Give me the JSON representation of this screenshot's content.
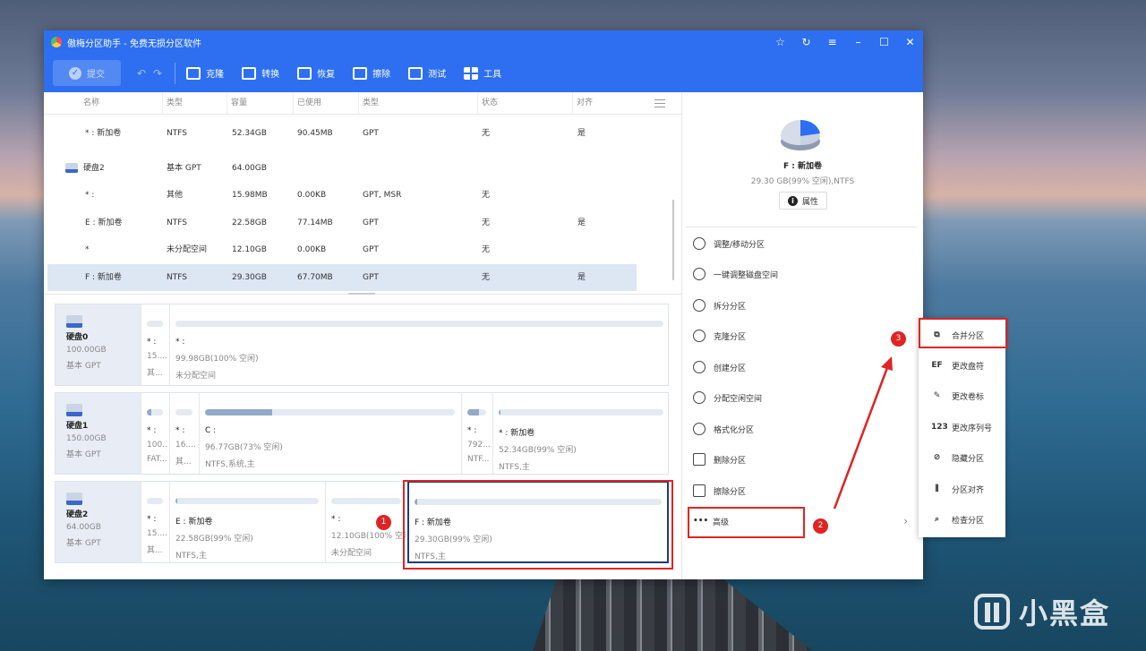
{
  "window": {
    "title": "傲梅分区助手 - 免费无损分区软件"
  },
  "toolbar": {
    "submit": "提交",
    "buttons": [
      {
        "label": "克隆",
        "icon": "clone-icon"
      },
      {
        "label": "转换",
        "icon": "convert-icon"
      },
      {
        "label": "恢复",
        "icon": "recover-icon"
      },
      {
        "label": "擦除",
        "icon": "wipe-icon"
      },
      {
        "label": "测试",
        "icon": "test-icon"
      },
      {
        "label": "工具",
        "icon": "tools-icon"
      }
    ]
  },
  "table": {
    "headers": [
      "名称",
      "类型",
      "容量",
      "已使用",
      "类型",
      "状态",
      "对齐"
    ],
    "rows": [
      {
        "name": "* : 新加卷",
        "type": "NTFS",
        "capacity": "52.34GB",
        "used": "90.45MB",
        "fs": "GPT",
        "status": "无",
        "align": "是"
      },
      {
        "name": "硬盘2",
        "type": "基本 GPT",
        "capacity": "64.00GB",
        "used": "",
        "fs": "",
        "status": "",
        "align": ""
      },
      {
        "name": "* :",
        "type": "其他",
        "capacity": "15.98MB",
        "used": "0.00KB",
        "fs": "GPT, MSR",
        "status": "无",
        "align": ""
      },
      {
        "name": "E : 新加卷",
        "type": "NTFS",
        "capacity": "22.58GB",
        "used": "77.14MB",
        "fs": "GPT",
        "status": "无",
        "align": "是"
      },
      {
        "name": "*",
        "type": "未分配空间",
        "capacity": "12.10GB",
        "used": "0.00KB",
        "fs": "GPT",
        "status": "无",
        "align": ""
      },
      {
        "name": "F : 新加卷",
        "type": "NTFS",
        "capacity": "29.30GB",
        "used": "67.70MB",
        "fs": "GPT",
        "status": "无",
        "align": "是"
      }
    ]
  },
  "disks": [
    {
      "name": "硬盘0",
      "size": "100.00GB",
      "type": "基本 GPT",
      "parts": [
        {
          "name": "* :",
          "line2": "15....",
          "line3": "其...",
          "fill": 0.0
        },
        {
          "name": "* :",
          "line2": "99.98GB(100% 空闲)",
          "line3": "未分配空间",
          "fill": 0.0
        }
      ]
    },
    {
      "name": "硬盘1",
      "size": "150.00GB",
      "type": "基本 GPT",
      "parts": [
        {
          "name": "* :",
          "line2": "100...",
          "line3": "FAT...",
          "fill": 0.3
        },
        {
          "name": "* :",
          "line2": "16....",
          "line3": "其...",
          "fill": 0.0
        },
        {
          "name": "C :",
          "line2": "96.77GB(73% 空闲)",
          "line3": "NTFS,系统,主",
          "fill": 0.27
        },
        {
          "name": "* :",
          "line2": "792....",
          "line3": "NTF...",
          "fill": 0.6
        },
        {
          "name": "* : 新加卷",
          "line2": "52.34GB(99% 空闲)",
          "line3": "NTFS,主",
          "fill": 0.01
        }
      ]
    },
    {
      "name": "硬盘2",
      "size": "64.00GB",
      "type": "基本 GPT",
      "parts": [
        {
          "name": "* :",
          "line2": "15....",
          "line3": "其...",
          "fill": 0.0
        },
        {
          "name": "E : 新加卷",
          "line2": "22.58GB(99% 空闲)",
          "line3": "NTFS,主",
          "fill": 0.01
        },
        {
          "name": "* :",
          "line2": "12.10GB(100% 空闲)",
          "line3": "未分配空间",
          "fill": 0.0
        },
        {
          "name": "F : 新加卷",
          "line2": "29.30GB(99% 空闲)",
          "line3": "NTFS,主",
          "fill": 0.01
        }
      ]
    }
  ],
  "panel": {
    "name": "F : 新加卷",
    "sub": "29.30 GB(99% 空闲),NTFS",
    "properties": "属性",
    "ops": [
      {
        "label": "调整/移动分区",
        "icon": "resize-move-icon"
      },
      {
        "label": "一键调整磁盘空间",
        "icon": "one-click-adjust-icon"
      },
      {
        "label": "拆分分区",
        "icon": "split-icon"
      },
      {
        "label": "克隆分区",
        "icon": "clone-partition-icon"
      },
      {
        "label": "创建分区",
        "icon": "create-partition-icon"
      },
      {
        "label": "分配空闲空间",
        "icon": "allocate-space-icon"
      },
      {
        "label": "格式化分区",
        "icon": "format-icon"
      },
      {
        "label": "删除分区",
        "icon": "delete-icon"
      },
      {
        "label": "擦除分区",
        "icon": "erase-icon"
      },
      {
        "label": "高级",
        "icon": "more-icon"
      }
    ]
  },
  "submenu": [
    {
      "label": "合并分区",
      "icon": "merge-icon",
      "glyph": "⧉"
    },
    {
      "label": "更改盘符",
      "icon": "drive-letter-icon",
      "glyph": "EF"
    },
    {
      "label": "更改卷标",
      "icon": "pencil-icon",
      "glyph": "✎"
    },
    {
      "label": "更改序列号",
      "icon": "serial-icon",
      "glyph": "123"
    },
    {
      "label": "隐藏分区",
      "icon": "hide-icon",
      "glyph": "⊘"
    },
    {
      "label": "分区对齐",
      "icon": "align-icon",
      "glyph": "⫼"
    },
    {
      "label": "检查分区",
      "icon": "search-icon",
      "glyph": "⌕"
    }
  ],
  "annotations": [
    "1",
    "2",
    "3"
  ],
  "watermark": "小黑盒",
  "colors": {
    "brand": "#2d6ff0",
    "highlight": "#e02424",
    "selected": "#1e3c78"
  }
}
